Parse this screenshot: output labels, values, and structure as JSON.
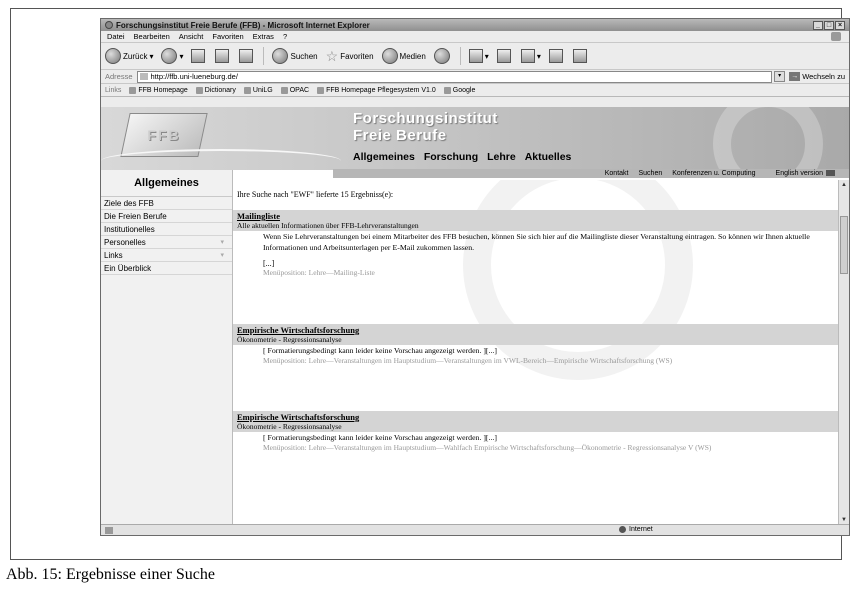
{
  "window": {
    "title": "Forschungsinstitut Freie Berufe (FFB) - Microsoft Internet Explorer"
  },
  "menu": [
    "Datei",
    "Bearbeiten",
    "Ansicht",
    "Favoriten",
    "Extras",
    "?"
  ],
  "toolbar": {
    "back": "Zurück",
    "search": "Suchen",
    "favorites": "Favoriten",
    "media": "Medien"
  },
  "address": {
    "label": "Adresse",
    "url": "http://ffb.uni-lueneburg.de/",
    "go": "Wechseln zu"
  },
  "links": {
    "label": "Links",
    "items": [
      "FFB Homepage",
      "Dictionary",
      "UniLG",
      "OPAC",
      "FFB Homepage Pflegesystem V1.0",
      "Google"
    ]
  },
  "banner": {
    "logo_text": "FFB",
    "title_line1": "Forschungsinstitut",
    "title_line2": "Freie Berufe",
    "nav": [
      "Allgemeines",
      "Forschung",
      "Lehre",
      "Aktuelles"
    ]
  },
  "subnav": [
    "Kontakt",
    "Suchen",
    "Konferenzen u. Computing",
    "English version"
  ],
  "sidebar": {
    "heading": "Allgemeines",
    "items": [
      {
        "label": "Ziele des FFB",
        "submenu": false
      },
      {
        "label": "Die Freien Berufe",
        "submenu": false
      },
      {
        "label": "Institutionelles",
        "submenu": false
      },
      {
        "label": "Personelles",
        "submenu": true
      },
      {
        "label": "Links",
        "submenu": true
      },
      {
        "label": "Ein Überblick",
        "submenu": false
      }
    ]
  },
  "search": {
    "intro": "Ihre Suche nach \"EWF\" lieferte 15 Ergebniss(e):",
    "results": [
      {
        "title": "Mailingliste",
        "subtitle": "Alle aktuellen Informationen über FFB-Lehrveranstaltungen",
        "body": "Wenn Sie Lehrveranstaltungen bei einem Mitarbeiter des FFB besuchen, können Sie sich hier auf die Mailingliste dieser Veranstaltung eintragen. So können wir Ihnen aktuelle Informationen und Arbeitsunterlagen per E-Mail zukommen lassen.",
        "more": "[...]",
        "path": "Menüposition: Lehre—Mailing-Liste"
      },
      {
        "title": "Empirische Wirtschaftsforschung",
        "subtitle": "Ökonometrie - Regressionsanalyse",
        "body": "[ Formatierungsbedingt kann leider keine Vorschau angezeigt werden. ][...]",
        "more": "",
        "path": "Menüposition: Lehre—Veranstaltungen im Hauptstudium—Veranstaltungen im VWL-Bereich—Empirische Wirtschaftsforschung (WS)"
      },
      {
        "title": "Empirische Wirtschaftsforschung",
        "subtitle": "Ökonometrie - Regressionsanalyse",
        "body": "[ Formatierungsbedingt kann leider keine Vorschau angezeigt werden. ][...]",
        "more": "",
        "path": "Menüposition: Lehre—Veranstaltungen im Hauptstudium—Wahlfach Empirische Wirtschaftsforschung—Ökonometrie - Regressionsanalyse V (WS)"
      }
    ]
  },
  "status": {
    "zone": "Internet"
  },
  "caption": "Abb. 15: Ergebnisse einer Suche"
}
